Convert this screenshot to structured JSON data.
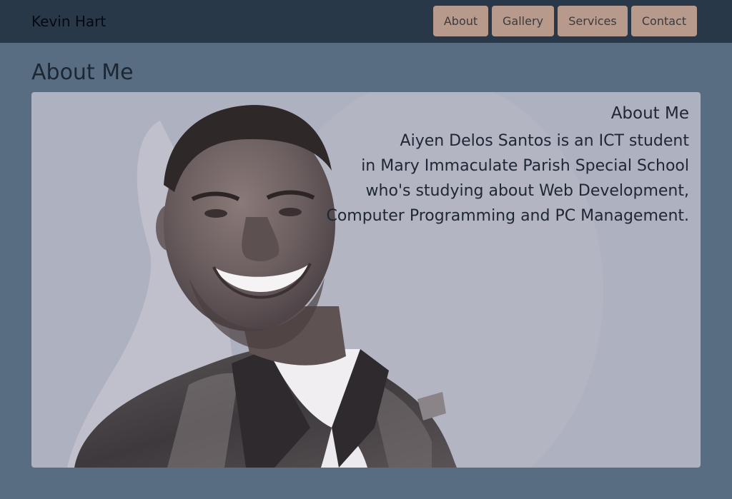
{
  "navbar": {
    "brand": "Kevin Hart",
    "links": [
      {
        "label": "About"
      },
      {
        "label": "Gallery"
      },
      {
        "label": "Services"
      },
      {
        "label": "Contact"
      }
    ]
  },
  "page": {
    "title": "About Me"
  },
  "card": {
    "heading": "About Me",
    "lines": [
      "Aiyen Delos Santos is an ICT student",
      "in Mary Immaculate Parish Special School",
      "who's studying about Web Development,",
      "Computer Programming and PC Management."
    ],
    "photo_icon": "portrait-photo"
  },
  "colors": {
    "page_bg": "#586d82",
    "navbar_bg": "#283848",
    "nav_button_bg": "#b79a8c",
    "card_bg": "#aeb1c0"
  }
}
